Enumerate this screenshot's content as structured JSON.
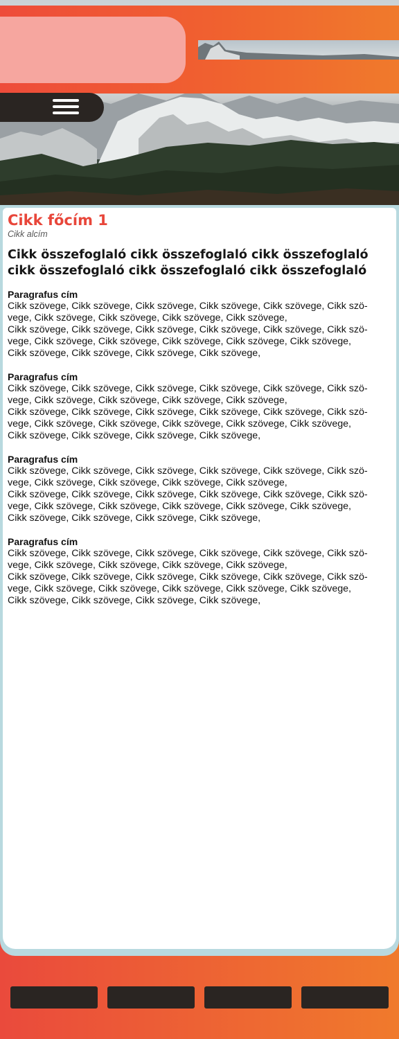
{
  "header": {
    "hero_image": "mountain-landscape",
    "menu_icon": "hamburger-icon"
  },
  "article": {
    "title": "Cikk főcím 1",
    "subtitle": "Cikk alcím",
    "summary": "Cikk összefoglaló cikk összefoglaló cikk összefoglaló cikk összefoglaló cikk összefoglaló cikk összefoglaló",
    "paragraphs": [
      {
        "title": "Paragrafus cím",
        "lines": [
          "Cikk szövege, Cikk szövege, Cikk szövege, Cikk szövege, Cikk szövege, Cikk szö-",
          "vege, Cikk szövege, Cikk szövege, Cikk szövege, Cikk szövege,",
          "Cikk szövege, Cikk szövege, Cikk szövege, Cikk szövege, Cikk szövege, Cikk szö-",
          "vege, Cikk szövege, Cikk szövege, Cikk szövege, Cikk szövege, Cikk szövege,",
          "Cikk szövege, Cikk szövege, Cikk szövege, Cikk szövege,"
        ]
      },
      {
        "title": "Paragrafus cím",
        "lines": [
          "Cikk szövege, Cikk szövege, Cikk szövege, Cikk szövege, Cikk szövege, Cikk szö-",
          "vege, Cikk szövege, Cikk szövege, Cikk szövege, Cikk szövege,",
          "Cikk szövege, Cikk szövege, Cikk szövege, Cikk szövege, Cikk szövege, Cikk szö-",
          "vege, Cikk szövege, Cikk szövege, Cikk szövege, Cikk szövege, Cikk szövege,",
          "Cikk szövege, Cikk szövege, Cikk szövege, Cikk szövege,"
        ]
      },
      {
        "title": "Paragrafus cím",
        "lines": [
          "Cikk szövege, Cikk szövege, Cikk szövege, Cikk szövege, Cikk szövege, Cikk szö-",
          "vege, Cikk szövege, Cikk szövege, Cikk szövege, Cikk szövege,",
          "Cikk szövege, Cikk szövege, Cikk szövege, Cikk szövege, Cikk szövege, Cikk szö-",
          "vege, Cikk szövege, Cikk szövege, Cikk szövege, Cikk szövege, Cikk szövege,",
          "Cikk szövege, Cikk szövege, Cikk szövege, Cikk szövege,"
        ]
      },
      {
        "title": "Paragrafus cím",
        "lines": [
          "Cikk szövege, Cikk szövege, Cikk szövege, Cikk szövege, Cikk szövege, Cikk szö-",
          "vege, Cikk szövege, Cikk szövege, Cikk szövege, Cikk szövege,",
          "Cikk szövege, Cikk szövege, Cikk szövege, Cikk szövege, Cikk szövege, Cikk szö-",
          "vege, Cikk szövege, Cikk szövege, Cikk szövege, Cikk szövege, Cikk szövege,",
          "Cikk szövege, Cikk szövege, Cikk szövege, Cikk szövege,"
        ]
      }
    ]
  },
  "bottom_nav": {
    "buttons": [
      "nav-button-1",
      "nav-button-2",
      "nav-button-3",
      "nav-button-4"
    ]
  },
  "colors": {
    "accent_red": "#e8463a",
    "gradient_start": "#ea4a3c",
    "gradient_end": "#f07a2c",
    "dark": "#2a2522",
    "card_border": "#b8d9df"
  }
}
